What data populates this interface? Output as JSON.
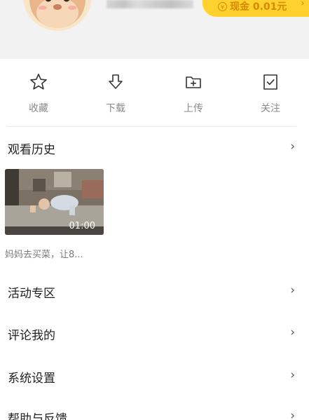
{
  "header": {
    "cash_label": "现金 0.01元",
    "cash_icon_glyph": "¥",
    "arrow_glyph": "›"
  },
  "quick_actions": [
    {
      "label": "收藏",
      "icon": "star-icon"
    },
    {
      "label": "下载",
      "icon": "download-arrow-icon"
    },
    {
      "label": "上传",
      "icon": "upload-folder-icon"
    },
    {
      "label": "关注",
      "icon": "follow-check-icon"
    }
  ],
  "history": {
    "title": "观看历史",
    "video": {
      "duration": "01:00",
      "title": "妈妈去买菜，让8..."
    }
  },
  "menu": [
    {
      "label": "活动专区"
    },
    {
      "label": "评论我的"
    },
    {
      "label": "系统设置"
    },
    {
      "label": "帮助与反馈"
    }
  ],
  "chevron": "›",
  "colors": {
    "accent": "#ffd12e",
    "accent_text": "#d48a00",
    "header_bg": "#f2f2f2"
  }
}
